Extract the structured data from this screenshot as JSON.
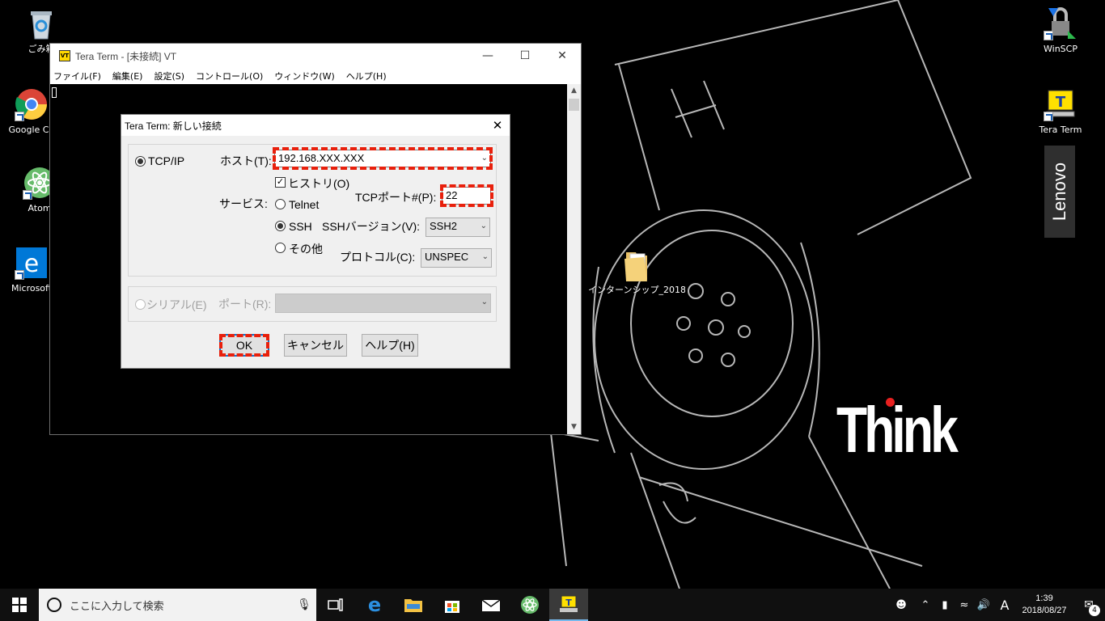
{
  "desktop": {
    "icons": [
      {
        "label": "ごみ箱",
        "icon": "recycle-bin-icon"
      },
      {
        "label": "Google Ch",
        "icon": "chrome-icon"
      },
      {
        "label": "Atom",
        "icon": "atom-icon"
      },
      {
        "label": "Microsoft",
        "icon": "edge-icon"
      },
      {
        "label": "WinSCP",
        "icon": "winscp-icon"
      },
      {
        "label": "Tera Term",
        "icon": "teraterm-icon"
      },
      {
        "label": "インターンシップ_2018",
        "icon": "folder-icon"
      }
    ],
    "lenovo_logo": "Lenovo",
    "think_logo": "Think"
  },
  "teraterm": {
    "title": "Tera Term - [未接続] VT",
    "app_icon_text": "VT",
    "menu": [
      "ファイル(F)",
      "編集(E)",
      "設定(S)",
      "コントロール(O)",
      "ウィンドウ(W)",
      "ヘルプ(H)"
    ]
  },
  "dialog": {
    "title": "Tera Term: 新しい接続",
    "tcpip_label": "TCP/IP",
    "host_label": "ホスト(T):",
    "host_value": "192.168.XXX.XXX",
    "history_label": "ヒストリ(O)",
    "service_label": "サービス:",
    "telnet_label": "Telnet",
    "tcp_port_label": "TCPポート#(P):",
    "tcp_port_value": "22",
    "ssh_label": "SSH",
    "ssh_version_label": "SSHバージョン(V):",
    "ssh_version_value": "SSH2",
    "other_label": "その他",
    "protocol_label": "プロトコル(C):",
    "protocol_value": "UNSPEC",
    "serial_label": "シリアル(E)",
    "port_label": "ポート(R):",
    "ok_label": "OK",
    "cancel_label": "キャンセル",
    "help_label": "ヘルプ(H)",
    "selected_service": "SSH",
    "history_checked": true
  },
  "taskbar": {
    "search_placeholder": "ここに入力して検索",
    "ime_indicator": "A",
    "time": "1:39",
    "date": "2018/08/27",
    "notification_count": "4"
  },
  "colors": {
    "annotation_red": "#e8200c",
    "accent_blue": "#0078d7",
    "think_dot": "#e8201f"
  }
}
